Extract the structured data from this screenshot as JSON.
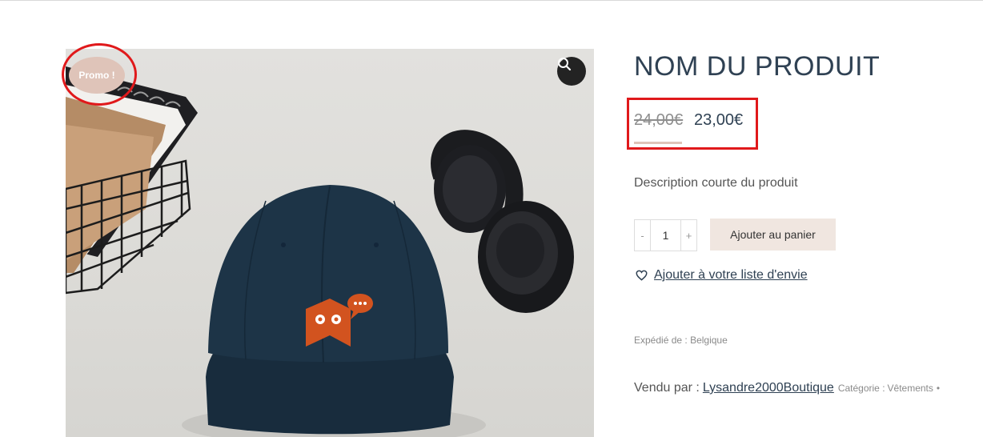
{
  "product": {
    "title": "NOM DU PRODUIT",
    "badge": "Promo !",
    "price_old": "24,00€",
    "price_new": "23,00€",
    "short_description": "Description courte du produit",
    "quantity": "1",
    "qty_minus": "-",
    "qty_plus": "+",
    "add_to_cart": "Ajouter au panier",
    "wishlist": "Ajouter à votre liste d'envie",
    "ships_from_label": "Expédié de :",
    "ships_from_value": "Belgique",
    "sold_by_label": "Vendu par :",
    "vendor": "Lysandre2000Boutique",
    "category_label": "Catégorie :",
    "category_value": "Vêtements",
    "separator": "•"
  },
  "colors": {
    "accent": "#dfc4b9",
    "title": "#2f4153",
    "highlight": "#e0191b",
    "cap": "#1d3447",
    "logo": "#d2531f"
  },
  "icons": {
    "zoom": "magnifier-icon",
    "wishlist": "heart-outline-icon"
  }
}
